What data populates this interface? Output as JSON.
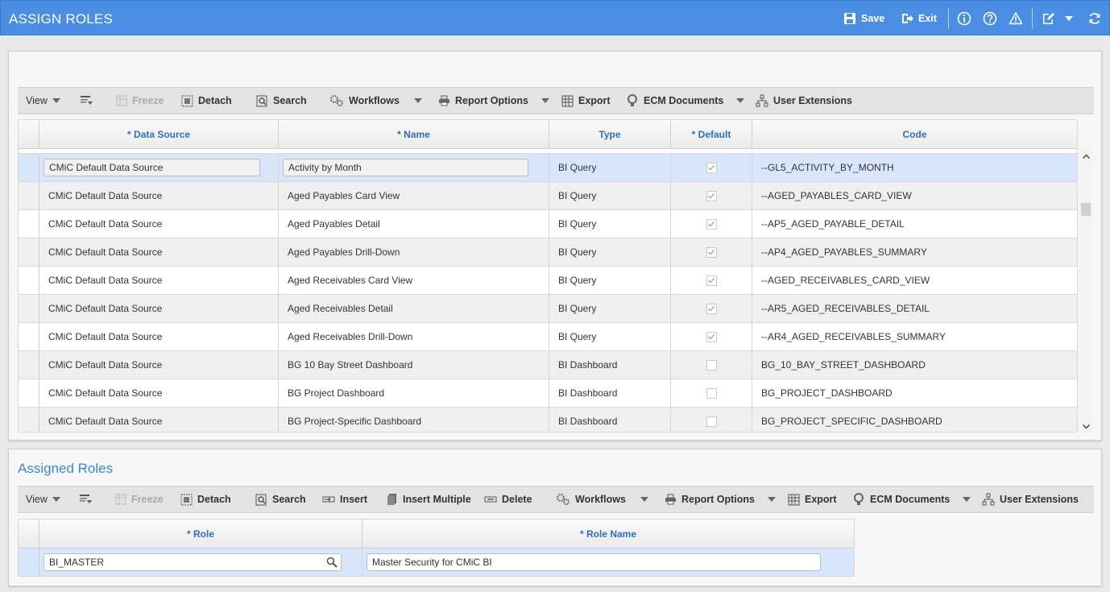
{
  "header": {
    "title": "ASSIGN ROLES",
    "save_label": "Save",
    "exit_label": "Exit",
    "icons": [
      "info-icon",
      "help-icon",
      "warning-icon",
      "edit-icon",
      "refresh-icon"
    ]
  },
  "toolbar1": {
    "view": "View",
    "freeze": "Freeze",
    "detach": "Detach",
    "search": "Search",
    "workflows": "Workflows",
    "report_options": "Report Options",
    "export": "Export",
    "ecm_documents": "ECM Documents",
    "user_extensions": "User Extensions"
  },
  "grid1": {
    "columns": [
      "* Data Source",
      "* Name",
      "Type",
      "* Default",
      "Code"
    ],
    "rows": [
      {
        "data_source": "CMiC Default Data Source",
        "name": "Activity by Month",
        "type": "BI Query",
        "default": true,
        "code": "--GL5_ACTIVITY_BY_MONTH"
      },
      {
        "data_source": "CMiC Default Data Source",
        "name": "Aged Payables Card View",
        "type": "BI Query",
        "default": true,
        "code": "--AGED_PAYABLES_CARD_VIEW"
      },
      {
        "data_source": "CMiC Default Data Source",
        "name": "Aged Payables Detail",
        "type": "BI Query",
        "default": true,
        "code": "--AP5_AGED_PAYABLE_DETAIL"
      },
      {
        "data_source": "CMiC Default Data Source",
        "name": "Aged Payables Drill-Down",
        "type": "BI Query",
        "default": true,
        "code": "--AP4_AGED_PAYABLES_SUMMARY"
      },
      {
        "data_source": "CMiC Default Data Source",
        "name": "Aged Receivables Card View",
        "type": "BI Query",
        "default": true,
        "code": "--AGED_RECEIVABLES_CARD_VIEW"
      },
      {
        "data_source": "CMiC Default Data Source",
        "name": "Aged Receivables Detail",
        "type": "BI Query",
        "default": true,
        "code": "--AR5_AGED_RECEIVABLES_DETAIL"
      },
      {
        "data_source": "CMiC Default Data Source",
        "name": "Aged Receivables Drill-Down",
        "type": "BI Query",
        "default": true,
        "code": "--AR4_AGED_RECEIVABLES_SUMMARY"
      },
      {
        "data_source": "CMiC Default Data Source",
        "name": "BG 10 Bay Street Dashboard",
        "type": "BI Dashboard",
        "default": false,
        "code": "BG_10_BAY_STREET_DASHBOARD"
      },
      {
        "data_source": "CMiC Default Data Source",
        "name": "BG Project Dashboard",
        "type": "BI Dashboard",
        "default": false,
        "code": "BG_PROJECT_DASHBOARD"
      },
      {
        "data_source": "CMiC Default Data Source",
        "name": "BG Project-Specific Dashboard",
        "type": "BI Dashboard",
        "default": false,
        "code": "BG_PROJECT_SPECIFIC_DASHBOARD"
      }
    ]
  },
  "assigned": {
    "title": "Assigned Roles"
  },
  "toolbar2": {
    "view": "View",
    "freeze": "Freeze",
    "detach": "Detach",
    "search": "Search",
    "insert": "Insert",
    "insert_multiple": "Insert Multiple",
    "delete": "Delete",
    "workflows": "Workflows",
    "report_options": "Report Options",
    "export": "Export",
    "ecm_documents": "ECM Documents",
    "user_extensions": "User Extensions"
  },
  "grid2": {
    "columns": [
      "* Role",
      "* Role Name"
    ],
    "rows": [
      {
        "role": "BI_MASTER",
        "role_name": "Master Security for CMiC BI"
      }
    ]
  },
  "colors": {
    "header_bg": "#4a8ee3",
    "link_blue": "#2a6fc4",
    "selected_row": "#d7e6fb"
  }
}
